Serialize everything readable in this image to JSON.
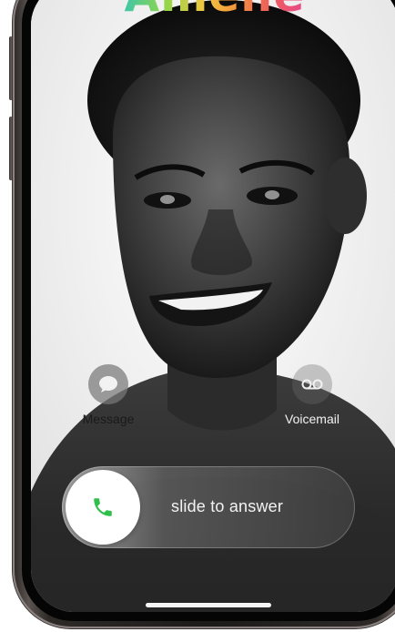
{
  "call": {
    "caller_name": "Amelie",
    "slider_text": "slide to answer"
  },
  "actions": [
    {
      "label": "Message",
      "icon": "message-bubble-icon"
    },
    {
      "label": "Voicemail",
      "icon": "voicemail-icon"
    }
  ],
  "slider": {
    "icon": "phone-icon",
    "accent_color": "#2fbf4a"
  },
  "name_gradient_colors": [
    "#3fc6a8",
    "#8fd64c",
    "#f5c542",
    "#f39a3b",
    "#ef5f5a",
    "#e74a8a"
  ]
}
